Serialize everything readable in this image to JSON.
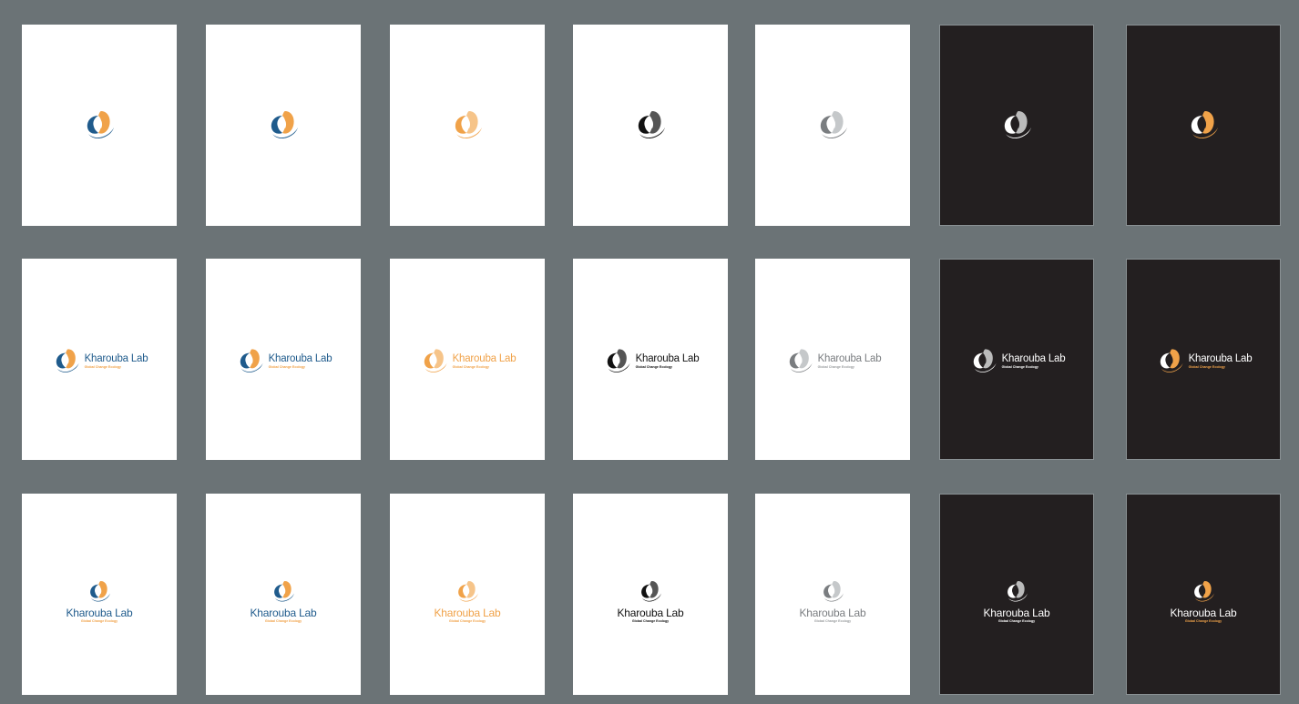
{
  "board": {
    "background": "#6b7376",
    "rows": [
      {
        "layout": "mark-only"
      },
      {
        "layout": "horizontal"
      },
      {
        "layout": "stacked"
      }
    ],
    "variants": [
      {
        "bg": "#ffffff",
        "theme": "light",
        "a": "#1f5b8c",
        "b": "#f0a249",
        "c": "#1f5b8c",
        "text": "#1f5b8c",
        "tag": "#f0a249"
      },
      {
        "bg": "#ffffff",
        "theme": "light",
        "a": "#1f5b8c",
        "b": "#f0a249",
        "c": "#1f5b8c",
        "text": "#1f5b8c",
        "tag": "#f0a249"
      },
      {
        "bg": "#ffffff",
        "theme": "light",
        "a": "#f0a249",
        "b": "#f6c489",
        "c": "#f0a249",
        "text": "#f0a249",
        "tag": "#f0a249"
      },
      {
        "bg": "#ffffff",
        "theme": "light",
        "a": "#111111",
        "b": "#555555",
        "c": "#111111",
        "text": "#111111",
        "tag": "#111111"
      },
      {
        "bg": "#ffffff",
        "theme": "light",
        "a": "#7a7d80",
        "b": "#c5c8ca",
        "c": "#7a7d80",
        "text": "#7a7d80",
        "tag": "#9a9d9f"
      },
      {
        "bg": "#231f20",
        "theme": "dark",
        "a": "#ffffff",
        "b": "#bbbbbb",
        "c": "#ffffff",
        "text": "#ffffff",
        "tag": "#ffffff"
      },
      {
        "bg": "#231f20",
        "theme": "dark",
        "a": "#ffffff",
        "b": "#f0a249",
        "c": "#f0a249",
        "text": "#ffffff",
        "tag": "#f0a249"
      }
    ]
  },
  "brand": {
    "name": "Kharouba Lab",
    "tagline": "Global Change Ecology"
  },
  "icons": {
    "logo_mark": "kharouba-lab-mark"
  }
}
